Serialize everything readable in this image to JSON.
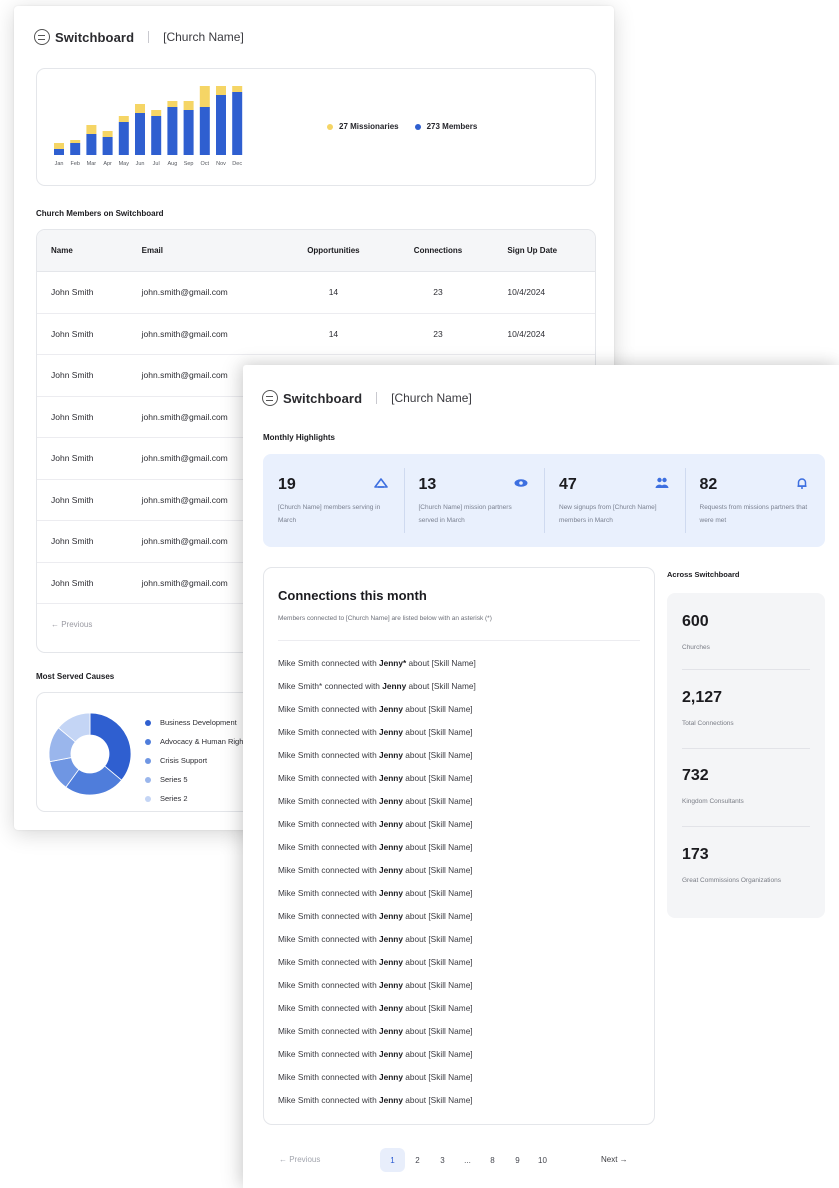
{
  "back": {
    "brand": "Switchboard",
    "church": "[Church Name]",
    "legend": {
      "missionaries": "27 Missionaries",
      "members": "273 Members"
    },
    "members_title": "Church Members on Switchboard",
    "columns": [
      "Name",
      "Email",
      "Opportunities",
      "Connections",
      "Sign Up Date"
    ],
    "rows": [
      [
        "John Smith",
        "john.smith@gmail.com",
        "14",
        "23",
        "10/4/2024"
      ],
      [
        "John Smith",
        "john.smith@gmail.com",
        "14",
        "23",
        "10/4/2024"
      ],
      [
        "John Smith",
        "john.smith@gmail.com",
        "",
        "",
        ""
      ],
      [
        "John Smith",
        "john.smith@gmail.com",
        "",
        "",
        ""
      ],
      [
        "John Smith",
        "john.smith@gmail.com",
        "",
        "",
        ""
      ],
      [
        "John Smith",
        "john.smith@gmail.com",
        "",
        "",
        ""
      ],
      [
        "John Smith",
        "john.smith@gmail.com",
        "",
        "",
        ""
      ],
      [
        "John Smith",
        "john.smith@gmail.com",
        "",
        "",
        ""
      ]
    ],
    "previous": "← Previous",
    "causes_title": "Most Served Causes",
    "causes": [
      "Business Development",
      "Advocacy & Human Rights",
      "Crisis Support",
      "Series 5",
      "Series 2"
    ]
  },
  "front": {
    "brand": "Switchboard",
    "church": "[Church Name]",
    "highlights_title": "Monthly Highlights",
    "highlights": [
      {
        "num": "19",
        "desc": "[Church Name] members serving in March",
        "icon": "hand-heart-icon"
      },
      {
        "num": "13",
        "desc": "[Church Name] mission partners served in March",
        "icon": "eye-icon"
      },
      {
        "num": "47",
        "desc": "New signups from [Church Name] members in March",
        "icon": "users-icon"
      },
      {
        "num": "82",
        "desc": "Requests from missions partners that were met",
        "icon": "bell-icon"
      }
    ],
    "connections": {
      "title": "Connections this month",
      "subtitle": "Members connected to [Church Name] are listed below with an asterisk (*)",
      "items": [
        {
          "a": "Mike Smith connected with ",
          "b": "Jenny*",
          "c": " about [Skill Name]"
        },
        {
          "a": "Mike Smith* connected with ",
          "b": "Jenny",
          "c": " about [Skill Name]"
        },
        {
          "a": "Mike Smith connected with ",
          "b": "Jenny",
          "c": " about [Skill Name]"
        },
        {
          "a": "Mike Smith connected with ",
          "b": "Jenny",
          "c": " about [Skill Name]"
        },
        {
          "a": "Mike Smith connected with ",
          "b": "Jenny",
          "c": " about [Skill Name]"
        },
        {
          "a": "Mike Smith connected with ",
          "b": "Jenny",
          "c": " about [Skill Name]"
        },
        {
          "a": "Mike Smith connected with ",
          "b": "Jenny",
          "c": " about [Skill Name]"
        },
        {
          "a": "Mike Smith connected with ",
          "b": "Jenny",
          "c": " about [Skill Name]"
        },
        {
          "a": "Mike Smith connected with ",
          "b": "Jenny",
          "c": " about [Skill Name]"
        },
        {
          "a": "Mike Smith connected with ",
          "b": "Jenny",
          "c": " about [Skill Name]"
        },
        {
          "a": "Mike Smith connected with ",
          "b": "Jenny",
          "c": " about [Skill Name]"
        },
        {
          "a": "Mike Smith connected with ",
          "b": "Jenny",
          "c": " about [Skill Name]"
        },
        {
          "a": "Mike Smith connected with ",
          "b": "Jenny",
          "c": " about [Skill Name]"
        },
        {
          "a": "Mike Smith connected with ",
          "b": "Jenny",
          "c": " about [Skill Name]"
        },
        {
          "a": "Mike Smith connected with ",
          "b": "Jenny",
          "c": " about [Skill Name]"
        },
        {
          "a": "Mike Smith connected with ",
          "b": "Jenny",
          "c": " about [Skill Name]"
        },
        {
          "a": "Mike Smith connected with ",
          "b": "Jenny",
          "c": " about [Skill Name]"
        },
        {
          "a": "Mike Smith connected with ",
          "b": "Jenny",
          "c": " about [Skill Name]"
        },
        {
          "a": "Mike Smith connected with ",
          "b": "Jenny",
          "c": " about [Skill Name]"
        },
        {
          "a": "Mike Smith connected with ",
          "b": "Jenny",
          "c": " about [Skill Name]"
        }
      ]
    },
    "across_title": "Across Switchboard",
    "stats": [
      {
        "val": "600",
        "lbl": "Churches"
      },
      {
        "val": "2,127",
        "lbl": "Total Connections"
      },
      {
        "val": "732",
        "lbl": "Kingdom Consultants"
      },
      {
        "val": "173",
        "lbl": "Great Commissions Organizations"
      }
    ],
    "pager": {
      "prev": "← Previous",
      "pages": [
        "1",
        "2",
        "3",
        "...",
        "8",
        "9",
        "10"
      ],
      "active": "1",
      "next": "Next →"
    }
  },
  "colors": {
    "blue": "#2f5fd0",
    "yellow": "#f5d565",
    "highlight_bg": "#e9f0fd",
    "icon_blue": "#3d6fe0"
  },
  "chart_data": {
    "type": "bar",
    "stacked": true,
    "categories": [
      "Jan",
      "Feb",
      "Mar",
      "Apr",
      "May",
      "Jun",
      "Jul",
      "Aug",
      "Sep",
      "Oct",
      "Nov",
      "Dec"
    ],
    "series": [
      {
        "name": "Members",
        "values": [
          2,
          4,
          7,
          6,
          11,
          14,
          13,
          16,
          15,
          16,
          20,
          21
        ],
        "color": "#2f5fd0"
      },
      {
        "name": "Missionaries",
        "values": [
          2,
          1,
          3,
          2,
          2,
          3,
          2,
          2,
          3,
          7,
          3,
          2
        ],
        "color": "#f5d565"
      }
    ],
    "ylim": [
      0,
      24
    ],
    "legend": "right"
  },
  "donut_data": {
    "type": "pie",
    "labels": [
      "Business Development",
      "Advocacy & Human Rights",
      "Crisis Support",
      "Series 5",
      "Series 2"
    ],
    "values": [
      36,
      24,
      12,
      14,
      14
    ],
    "colors": [
      "#2f5fd0",
      "#4f7ddb",
      "#6f96e3",
      "#9ab6ec",
      "#c4d5f5"
    ]
  }
}
